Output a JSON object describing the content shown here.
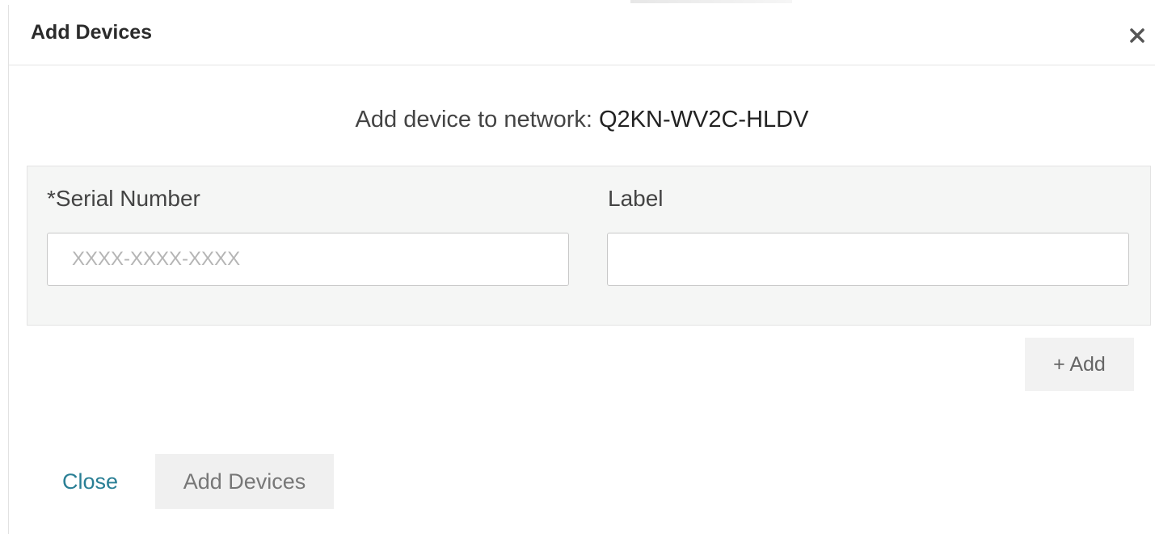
{
  "modal": {
    "title": "Add Devices",
    "close_icon": "close-icon"
  },
  "network": {
    "prefix": "Add device to network:",
    "name": "Q2KN-WV2C-HLDV"
  },
  "form": {
    "serial_label": "*Serial Number",
    "serial_placeholder": "XXXX-XXXX-XXXX",
    "serial_value": "",
    "label_label": "Label",
    "label_placeholder": "",
    "label_value": ""
  },
  "actions": {
    "add_row_label": "+ Add",
    "close_label": "Close",
    "add_devices_label": "Add Devices"
  },
  "colors": {
    "link": "#2a7f95",
    "panel_background": "#f5f6f5",
    "button_background": "#f0f0f0"
  }
}
